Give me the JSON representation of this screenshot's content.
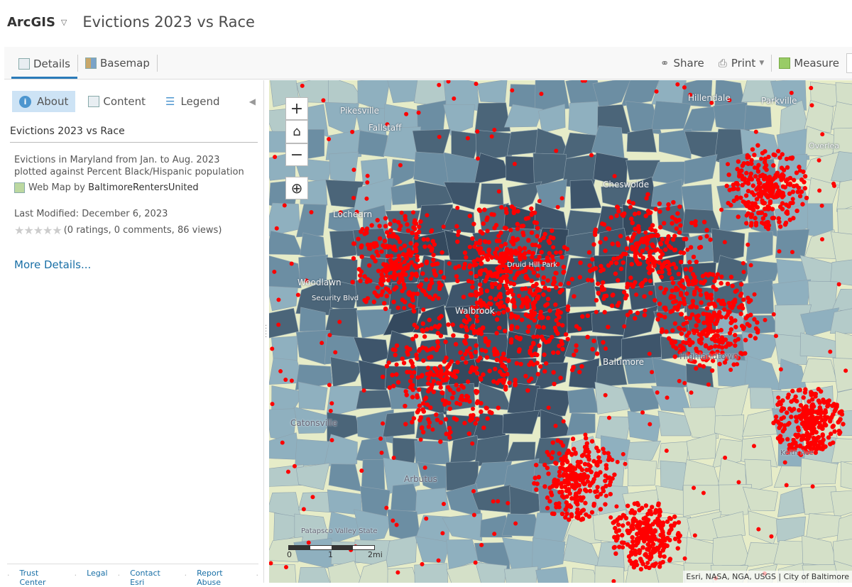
{
  "header": {
    "brand": "ArcGIS",
    "title": "Evictions 2023 vs Race"
  },
  "toolbar": {
    "details": "Details",
    "basemap": "Basemap",
    "share": "Share",
    "print": "Print",
    "measure": "Measure"
  },
  "panel": {
    "tabs": [
      {
        "label": "About"
      },
      {
        "label": "Content"
      },
      {
        "label": "Legend"
      }
    ],
    "title": "Evictions 2023 vs Race",
    "description": "Evictions in Maryland from Jan. to Aug. 2023 plotted against Percent Black/Hispanic population",
    "webmap_prefix": "Web Map by",
    "owner": "BaltimoreRentersUnited",
    "last_modified": "Last Modified: December 6, 2023",
    "stars": "★★★★★",
    "rating_fraction": 0,
    "ratings": "(0 ratings, 0 comments, 86 views)",
    "more": "More Details...",
    "footer": [
      "Trust Center",
      "Legal",
      "Contact Esri",
      "Report Abuse"
    ]
  },
  "map": {
    "labels": [
      "Pikesville",
      "Fallstaff",
      "Lochearn",
      "Woodlawn",
      "Security Blvd",
      "Walbrook",
      "Druid Hill Park",
      "Catonsville",
      "Arbutus",
      "Patapsco Valley State",
      "Hillendale",
      "Parkville",
      "Overlea",
      "Highlandtown",
      "Keith Ave",
      "Baltimore",
      "Cheswolde"
    ],
    "scale": [
      "0",
      "1",
      "2mi"
    ],
    "attribution": "Esri, NASA, NGA, USGS | City of Baltimore",
    "colors": {
      "dot": "#ff0000",
      "high": "#34495e",
      "mid": "#7f9eb0",
      "low": "#e6ecc8"
    }
  }
}
